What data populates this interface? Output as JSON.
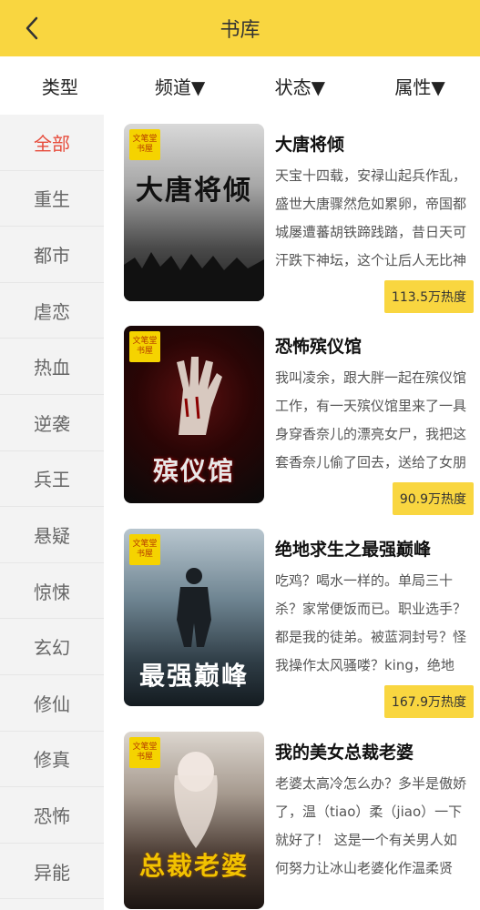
{
  "header": {
    "title": "书库",
    "back_icon": "chevron-left-icon"
  },
  "filters": [
    "类型",
    "频道▼",
    "状态▼",
    "属性▼"
  ],
  "categories": [
    "全部",
    "重生",
    "都市",
    "虐恋",
    "热血",
    "逆袭",
    "兵王",
    "悬疑",
    "惊悚",
    "玄幻",
    "修仙",
    "修真",
    "恐怖",
    "异能"
  ],
  "active_category": "全部",
  "colors": {
    "accent": "#f9d640",
    "active_text": "#e74c3c"
  },
  "books": [
    {
      "title": "大唐将倾",
      "cover_badge": "文笔堂书屋",
      "cover_title": "大唐将倾",
      "description": "天宝十四载，安禄山起兵作乱，盛世大唐骤然危如累卵，帝国都城屡遭蕃胡铁蹄践踏，昔日天可汗跌下神坛，这个让后人无比神往的时代...",
      "heat": "113.5万热度"
    },
    {
      "title": "恐怖殡仪馆",
      "cover_badge": "文笔堂书屋",
      "cover_title": "殡仪馆",
      "description": "我叫凌余，跟大胖一起在殡仪馆工作，有一天殡仪馆里来了一具身穿香奈儿的漂亮女尸，我把这套香奈儿偷了回去，送给了女朋友...",
      "heat": "90.9万热度"
    },
    {
      "title": "绝地求生之最强巅峰",
      "cover_badge": "文笔堂书屋",
      "cover_title": "最强巅峰",
      "description": "吃鸡？喝水一样的。单局三十杀？家常便饭而已。职业选手？都是我的徒弟。被蓝洞封号？怪我操作太风骚喽？king，绝地求生...",
      "heat": "167.9万热度"
    },
    {
      "title": "我的美女总裁老婆",
      "cover_badge": "文笔堂书屋",
      "cover_title": "总裁老婆",
      "description": "老婆太高冷怎么办？多半是傲娇了，温（tiao）柔（jiao）一下就好了！ 这是一个有关男人如何努力让冰山老婆化作温柔贤惠...",
      "heat": ""
    }
  ]
}
